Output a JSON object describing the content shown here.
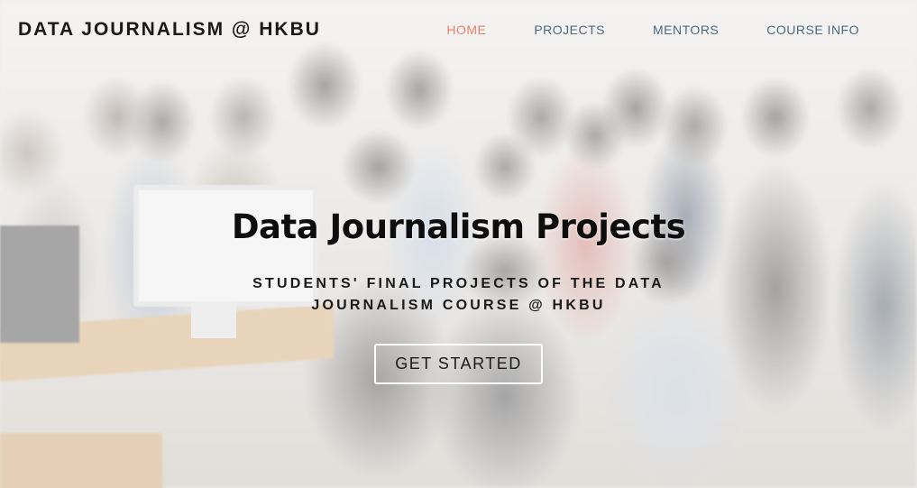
{
  "brand": "DATA JOURNALISM @ HKBU",
  "nav": {
    "items": [
      {
        "label": "HOME",
        "active": true
      },
      {
        "label": "PROJECTS",
        "active": false
      },
      {
        "label": "MENTORS",
        "active": false
      },
      {
        "label": "COURSE INFO",
        "active": false
      }
    ]
  },
  "hero": {
    "title": "Data Journalism Projects",
    "subtitle": "STUDENTS' FINAL PROJECTS OF THE DATA JOURNALISM COURSE @ HKBU",
    "button_label": "GET STARTED"
  },
  "colors": {
    "nav_link": "#4b6a7d",
    "nav_active": "#e8826b",
    "text_dark": "#1a1a1a"
  }
}
